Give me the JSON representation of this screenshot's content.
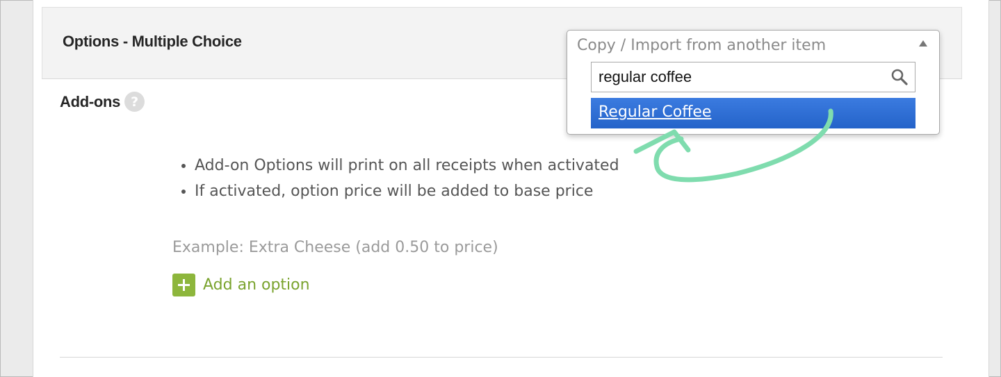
{
  "section": {
    "title": "Options - Multiple Choice"
  },
  "addons": {
    "label": "Add-ons",
    "help_glyph": "?",
    "bullets": [
      "Add-on Options will print on all receipts when activated",
      "If activated, option price will be added to base price"
    ],
    "example": "Example: Extra Cheese (add 0.50 to price)",
    "add_option_label": "Add an option"
  },
  "copy_import": {
    "header": "Copy / Import from another item",
    "search_value": "regular coffee",
    "results": [
      "Regular Coffee"
    ]
  },
  "colors": {
    "highlight": "#2463c9",
    "accent_green": "#8db63c",
    "annotation": "#7fdcae"
  },
  "icons": {
    "help": "help-icon",
    "search": "search-icon",
    "dropdown_arrow": "caret-up-icon",
    "add": "plus-icon",
    "annotation": "curved-arrow-icon"
  }
}
